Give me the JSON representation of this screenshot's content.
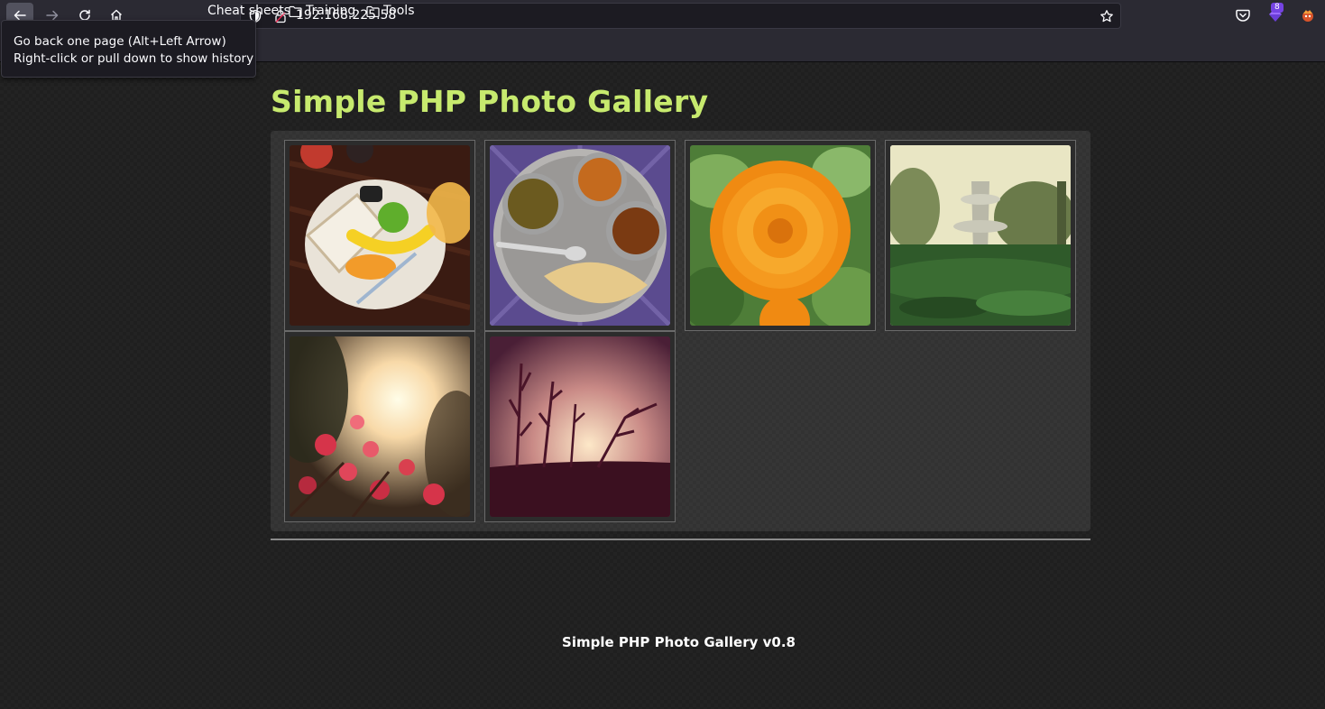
{
  "browser": {
    "url": "192.168.225.58",
    "extension_badge": "8",
    "bookmarks": {
      "cheat_sheets": "Cheat sheets",
      "training": "Training",
      "tools": "Tools"
    },
    "tooltip": {
      "line1": "Go back one page (Alt+Left Arrow)",
      "line2": "Right-click or pull down to show history"
    }
  },
  "page": {
    "title": "Simple PHP Photo Gallery",
    "footer": "Simple PHP Photo Gallery v0.8"
  },
  "gallery": {
    "photos": [
      {
        "subject": "breakfast plate"
      },
      {
        "subject": "thali meal"
      },
      {
        "subject": "orange flower"
      },
      {
        "subject": "garden fountain"
      },
      {
        "subject": "bougainvillea at sunset"
      },
      {
        "subject": "plant silhouette at sunset"
      }
    ]
  },
  "colors": {
    "title_accent": "#c7ea6e",
    "chrome_bg": "#2b2a33"
  },
  "icons": [
    "back-icon",
    "forward-icon",
    "reload-icon",
    "home-icon",
    "shield-icon",
    "lock-icon",
    "star-icon",
    "pocket-icon",
    "extension-icon",
    "profile-icon",
    "folder-icon"
  ]
}
